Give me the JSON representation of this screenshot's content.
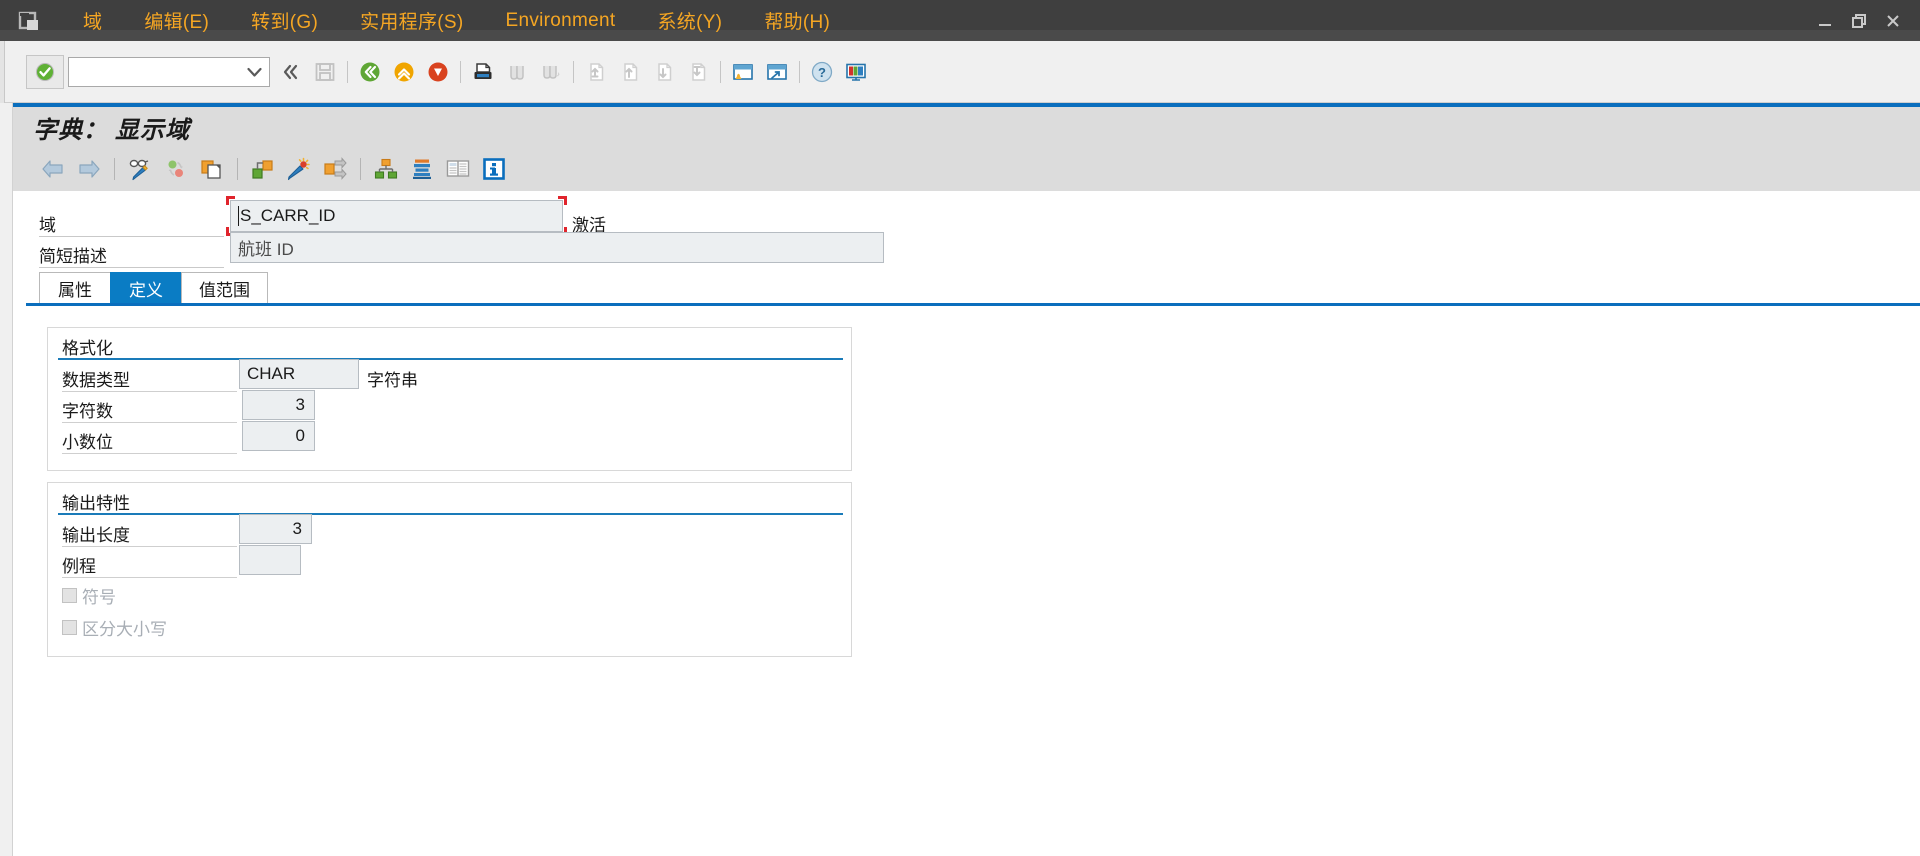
{
  "window": {
    "logo_icon": "sap-session-icon",
    "controls": [
      {
        "name": "minimize-button",
        "glyph": "—"
      },
      {
        "name": "restore-button",
        "glyph": "❐"
      },
      {
        "name": "close-button",
        "glyph": "✕"
      }
    ]
  },
  "menubar": {
    "items": [
      {
        "label": "域",
        "key": ""
      },
      {
        "label": "编辑(E)",
        "key": "E"
      },
      {
        "label": "转到(G)",
        "key": "G"
      },
      {
        "label": "实用程序(S)",
        "key": "S"
      },
      {
        "label": "Environment",
        "key": "v"
      },
      {
        "label": "系统(Y)",
        "key": "Y"
      },
      {
        "label": "帮助(H)",
        "key": "H"
      }
    ],
    "text_color": "#f5a623",
    "background": "#3f3f3f"
  },
  "toolbar": {
    "ok_button": {
      "name": "enter-ok-icon",
      "title": "继续"
    },
    "command_field": {
      "value": "",
      "placeholder": ""
    },
    "buttons": [
      {
        "name": "collapse-left-icon",
        "glyph": "«"
      },
      {
        "name": "save-icon"
      },
      {
        "name": "back-icon"
      },
      {
        "name": "exit-icon"
      },
      {
        "name": "cancel-icon"
      },
      {
        "name": "print-icon"
      },
      {
        "name": "find-icon"
      },
      {
        "name": "find-next-icon"
      },
      {
        "name": "first-page-icon"
      },
      {
        "name": "previous-page-icon"
      },
      {
        "name": "next-page-icon"
      },
      {
        "name": "last-page-icon"
      },
      {
        "name": "create-session-icon"
      },
      {
        "name": "create-shortcut-icon"
      },
      {
        "name": "help-icon"
      },
      {
        "name": "customize-layout-icon"
      }
    ]
  },
  "title": {
    "text": "字典： 显示域"
  },
  "apptoolbar": {
    "buttons": [
      {
        "name": "previous-object-icon"
      },
      {
        "name": "next-object-icon"
      },
      {
        "name": "display-change-icon"
      },
      {
        "name": "activate-icon"
      },
      {
        "name": "copy-object-icon"
      },
      {
        "name": "where-used-list-icon"
      },
      {
        "name": "generate-icon"
      },
      {
        "name": "navigate-icon"
      },
      {
        "name": "hierarchy-icon"
      },
      {
        "name": "database-object-icon"
      },
      {
        "name": "documentation-icon"
      },
      {
        "name": "info-icon"
      }
    ]
  },
  "header": {
    "domain_label": "域",
    "domain_value": "S_CARR_ID",
    "status_text": "激活",
    "short_desc_label": "简短描述",
    "short_desc_value": "航班 ID"
  },
  "tabs": [
    {
      "label": "属性",
      "name": "tab-attributes",
      "active": false
    },
    {
      "label": "定义",
      "name": "tab-definition",
      "active": true
    },
    {
      "label": "值范围",
      "name": "tab-value-range",
      "active": false
    }
  ],
  "formatting": {
    "group_title": "格式化",
    "data_type_label": "数据类型",
    "data_type_value": "CHAR",
    "data_type_desc": "字符串",
    "length_label": "字符数",
    "length_value": "3",
    "decimals_label": "小数位",
    "decimals_value": "0"
  },
  "output": {
    "group_title": "输出特性",
    "output_length_label": "输出长度",
    "output_length_value": "3",
    "conv_routine_label": "例程",
    "conv_routine_value": "",
    "sign_label": "符号",
    "sign_checked": false,
    "lowercase_label": "区分大小写",
    "lowercase_checked": false
  },
  "colors": {
    "menu_text": "#f5a623",
    "menu_bg": "#3f3f3f",
    "accent_blue": "#0a6ebd",
    "tab_active": "#0a7cc4",
    "focus_red": "#e0242c",
    "field_bg": "#eceff1",
    "title_bg": "#dcdcdc"
  }
}
